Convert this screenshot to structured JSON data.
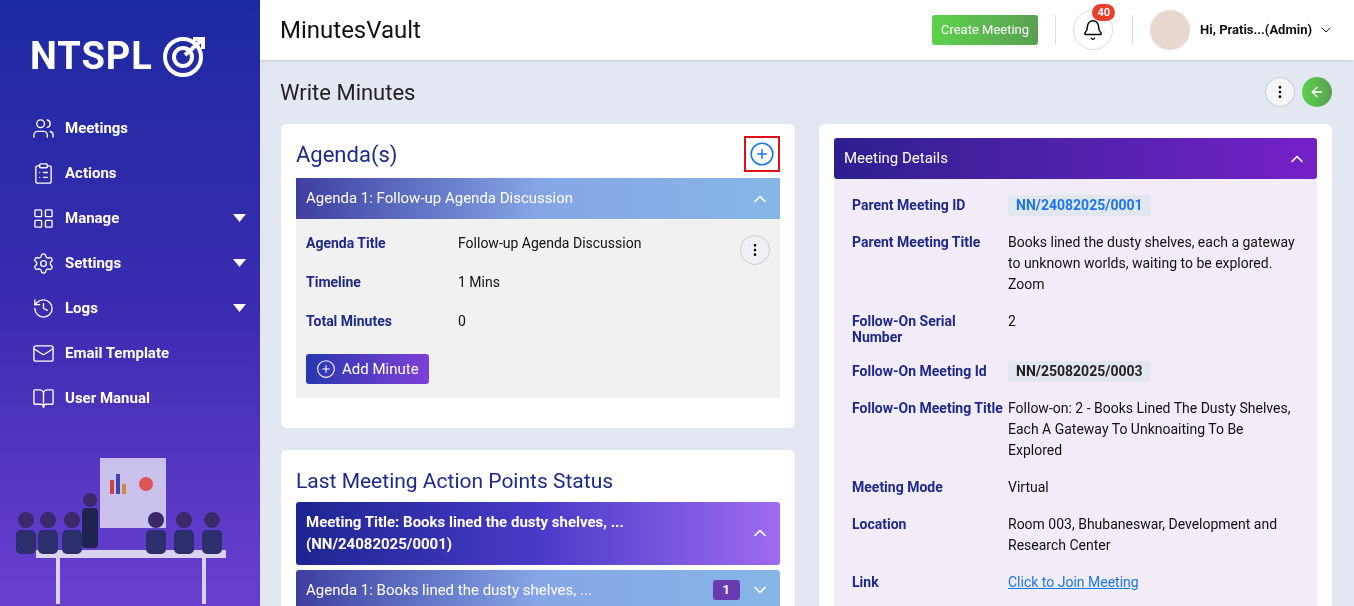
{
  "sidebar": {
    "logo": "NTSPL",
    "items": [
      {
        "label": "Meetings",
        "has_caret": false
      },
      {
        "label": "Actions",
        "has_caret": false
      },
      {
        "label": "Manage",
        "has_caret": true
      },
      {
        "label": "Settings",
        "has_caret": true
      },
      {
        "label": "Logs",
        "has_caret": true
      },
      {
        "label": "Email Template",
        "has_caret": false
      },
      {
        "label": "User Manual",
        "has_caret": false
      }
    ]
  },
  "header": {
    "app_title": "MinutesVault",
    "create_button": "Create Meeting",
    "notification_count": "40",
    "user_greeting": "Hi, Pratis...(Admin)"
  },
  "page_title": "Write Minutes",
  "agendas": {
    "title": "Agenda(s)",
    "items": [
      {
        "header": "Agenda 1: Follow-up Agenda Discussion",
        "expanded": true,
        "fields": [
          {
            "label": "Agenda Title",
            "value": "Follow-up Agenda Discussion"
          },
          {
            "label": "Timeline",
            "value": "1 Mins"
          },
          {
            "label": "Total Minutes",
            "value": "0"
          }
        ],
        "add_button": "Add Minute"
      }
    ]
  },
  "last_meeting": {
    "title": "Last Meeting Action Points Status",
    "meeting_header": "Meeting Title: Books lined the dusty shelves, ...",
    "meeting_id": "(NN/24082025/0001)",
    "expanded": true,
    "agendas": [
      {
        "header": "Agenda 1: Books lined the dusty shelves, ...",
        "count": "1",
        "expanded": false
      }
    ]
  },
  "meeting_details": {
    "title": "Meeting Details",
    "expanded": true,
    "rows": [
      {
        "label": "Parent Meeting ID",
        "value": "NN/24082025/0001",
        "kind": "pill-link"
      },
      {
        "label": "Parent Meeting Title",
        "value": "Books lined the dusty shelves, each a gateway to unknown worlds, waiting to be explored. Zoom",
        "kind": "text"
      },
      {
        "label": "Follow-On Serial Number",
        "value": "2",
        "kind": "text"
      },
      {
        "label": "Follow-On Meeting Id",
        "value": "NN/25082025/0003",
        "kind": "pill"
      },
      {
        "label": "Follow-On Meeting Title",
        "value": "Follow-on: 2 - Books Lined The Dusty Shelves, Each A Gateway To Unknoaiting To Be Explored",
        "kind": "text"
      },
      {
        "label": "Meeting Mode",
        "value": "Virtual",
        "kind": "text"
      },
      {
        "label": "Location",
        "value": "Room 003, Bhubaneswar, Development and Research Center",
        "kind": "text"
      },
      {
        "label": "Link",
        "value": "Click to Join Meeting",
        "kind": "link"
      }
    ]
  }
}
